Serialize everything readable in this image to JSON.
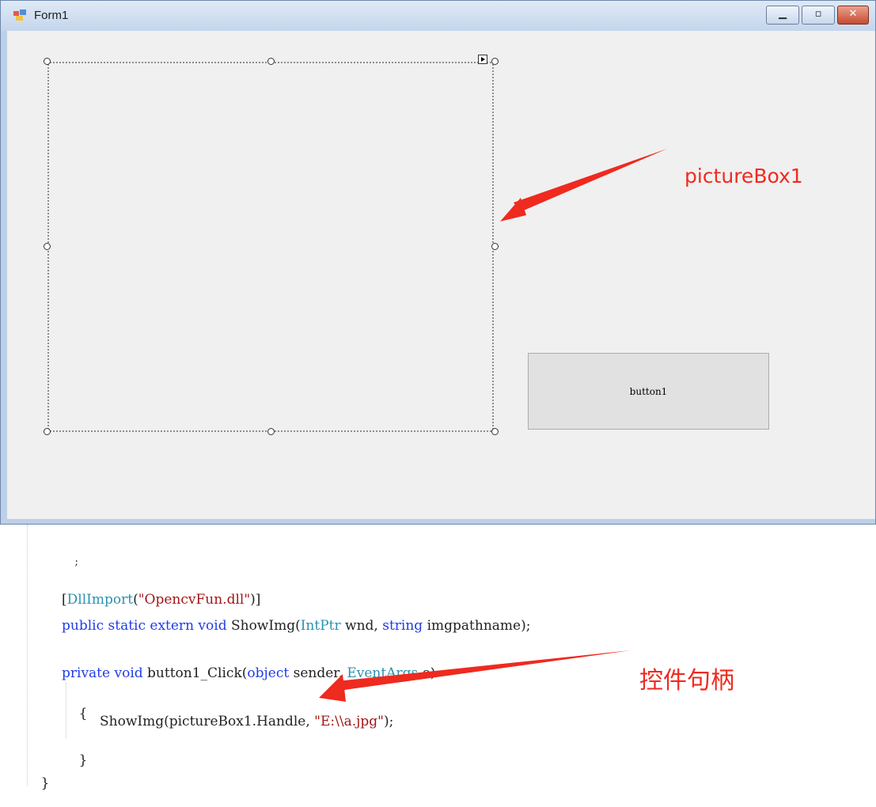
{
  "window": {
    "title": "Form1",
    "controls": {
      "minimize_icon": "minimize-icon",
      "maximize_icon": "maximize-icon",
      "close_icon": "close-icon"
    }
  },
  "form": {
    "picturebox_name": "pictureBox1",
    "button_label": "button1"
  },
  "annotations": {
    "picturebox_label": "pictureBox1",
    "handle_label": "控件句柄",
    "color": "#ef2a1f"
  },
  "code": {
    "lines": [
      ";",
      "[DllImport(\"OpencvFun.dll\")]",
      "public static extern void ShowImg(IntPtr wnd, string imgpathname);",
      "private void button1_Click(object sender, EventArgs e)",
      "{",
      "ShowImg(pictureBox1.Handle, \"E:\\\\a.jpg\");",
      "}",
      "}"
    ],
    "tokens": {
      "l2_open": "[",
      "l2_attr": "DllImport",
      "l2_paren": "(",
      "l2_str": "\"OpencvFun.dll\"",
      "l2_close": ")]",
      "l3_kw": "public static extern void",
      "l3_name": " ShowImg(",
      "l3_type": "IntPtr",
      "l3_mid": " wnd, ",
      "l3_kw2": "string",
      "l3_end": " imgpathname);",
      "l4_kw": "private void",
      "l4_name": " button1_Click(",
      "l4_kw2": "object",
      "l4_mid": " sender, ",
      "l4_type": "EventArgs",
      "l4_end": " e)",
      "l6_call": "ShowImg(pictureBox1.Handle, ",
      "l6_str": "\"E:\\\\a.jpg\"",
      "l6_end": ");"
    }
  }
}
